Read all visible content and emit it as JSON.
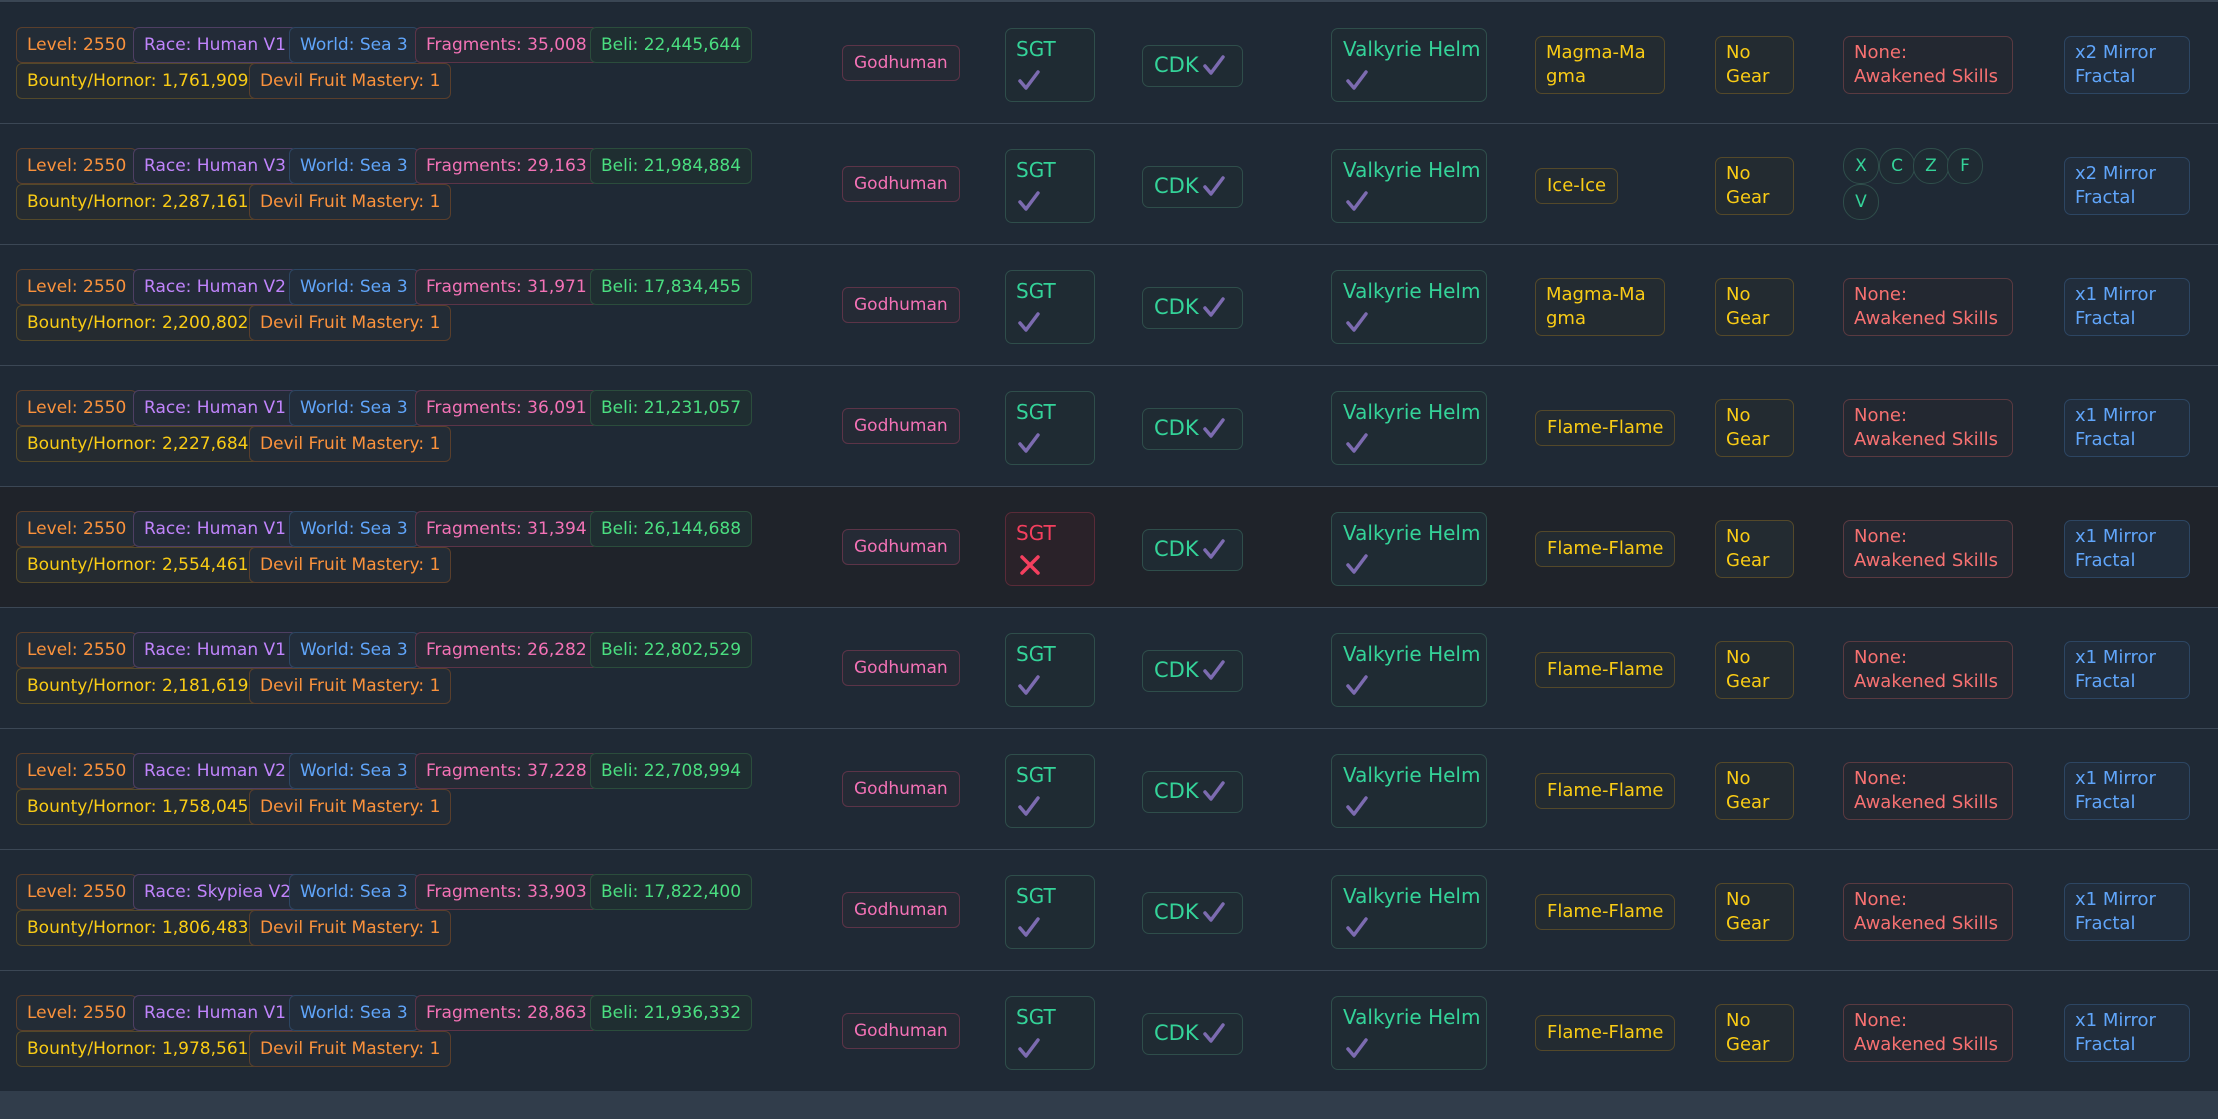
{
  "rows": [
    {
      "level": "Level: 2550",
      "race": "Race: Human V1",
      "world": "World: Sea 3",
      "fragments": "Fragments: 35,008",
      "beli": "Beli: 22,445,644",
      "bounty": "Bounty/Hornor: 1,761,909",
      "mastery": "Devil Fruit Mastery: 1",
      "style": "Godhuman",
      "sgt_label": "SGT",
      "sgt_ok": true,
      "cdk_label": "CDK",
      "helm_label": "Valkyrie Helm",
      "fruit": "Magma-Magma",
      "gear": "No Gear",
      "awakened": "None: Awakened Skills",
      "awakened_keys": [],
      "mirror": "x2 Mirror Fractal",
      "dim": false
    },
    {
      "level": "Level: 2550",
      "race": "Race: Human V3",
      "world": "World: Sea 3",
      "fragments": "Fragments: 29,163",
      "beli": "Beli: 21,984,884",
      "bounty": "Bounty/Hornor: 2,287,161",
      "mastery": "Devil Fruit Mastery: 1",
      "style": "Godhuman",
      "sgt_label": "SGT",
      "sgt_ok": true,
      "cdk_label": "CDK",
      "helm_label": "Valkyrie Helm",
      "fruit": "Ice-Ice",
      "gear": "No Gear",
      "awakened": "",
      "awakened_keys": [
        "X",
        "C",
        "Z",
        "F",
        "V"
      ],
      "mirror": "x2 Mirror Fractal",
      "dim": false
    },
    {
      "level": "Level: 2550",
      "race": "Race: Human V2",
      "world": "World: Sea 3",
      "fragments": "Fragments: 31,971",
      "beli": "Beli: 17,834,455",
      "bounty": "Bounty/Hornor: 2,200,802",
      "mastery": "Devil Fruit Mastery: 1",
      "style": "Godhuman",
      "sgt_label": "SGT",
      "sgt_ok": true,
      "cdk_label": "CDK",
      "helm_label": "Valkyrie Helm",
      "fruit": "Magma-Magma",
      "gear": "No Gear",
      "awakened": "None: Awakened Skills",
      "awakened_keys": [],
      "mirror": "x1 Mirror Fractal",
      "dim": false
    },
    {
      "level": "Level: 2550",
      "race": "Race: Human V1",
      "world": "World: Sea 3",
      "fragments": "Fragments: 36,091",
      "beli": "Beli: 21,231,057",
      "bounty": "Bounty/Hornor: 2,227,684",
      "mastery": "Devil Fruit Mastery: 1",
      "style": "Godhuman",
      "sgt_label": "SGT",
      "sgt_ok": true,
      "cdk_label": "CDK",
      "helm_label": "Valkyrie Helm",
      "fruit": "Flame-Flame",
      "gear": "No Gear",
      "awakened": "None: Awakened Skills",
      "awakened_keys": [],
      "mirror": "x1 Mirror Fractal",
      "dim": false
    },
    {
      "level": "Level: 2550",
      "race": "Race: Human V1",
      "world": "World: Sea 3",
      "fragments": "Fragments: 31,394",
      "beli": "Beli: 26,144,688",
      "bounty": "Bounty/Hornor: 2,554,461",
      "mastery": "Devil Fruit Mastery: 1",
      "style": "Godhuman",
      "sgt_label": "SGT",
      "sgt_ok": false,
      "cdk_label": "CDK",
      "helm_label": "Valkyrie Helm",
      "fruit": "Flame-Flame",
      "gear": "No Gear",
      "awakened": "None: Awakened Skills",
      "awakened_keys": [],
      "mirror": "x1 Mirror Fractal",
      "dim": true
    },
    {
      "level": "Level: 2550",
      "race": "Race: Human V1",
      "world": "World: Sea 3",
      "fragments": "Fragments: 26,282",
      "beli": "Beli: 22,802,529",
      "bounty": "Bounty/Hornor: 2,181,619",
      "mastery": "Devil Fruit Mastery: 1",
      "style": "Godhuman",
      "sgt_label": "SGT",
      "sgt_ok": true,
      "cdk_label": "CDK",
      "helm_label": "Valkyrie Helm",
      "fruit": "Flame-Flame",
      "gear": "No Gear",
      "awakened": "None: Awakened Skills",
      "awakened_keys": [],
      "mirror": "x1 Mirror Fractal",
      "dim": false
    },
    {
      "level": "Level: 2550",
      "race": "Race: Human V2",
      "world": "World: Sea 3",
      "fragments": "Fragments: 37,228",
      "beli": "Beli: 22,708,994",
      "bounty": "Bounty/Hornor: 1,758,045",
      "mastery": "Devil Fruit Mastery: 1",
      "style": "Godhuman",
      "sgt_label": "SGT",
      "sgt_ok": true,
      "cdk_label": "CDK",
      "helm_label": "Valkyrie Helm",
      "fruit": "Flame-Flame",
      "gear": "No Gear",
      "awakened": "None: Awakened Skills",
      "awakened_keys": [],
      "mirror": "x1 Mirror Fractal",
      "dim": false
    },
    {
      "level": "Level: 2550",
      "race": "Race: Skypiea V2",
      "world": "World: Sea 3",
      "fragments": "Fragments: 33,903",
      "beli": "Beli: 17,822,400",
      "bounty": "Bounty/Hornor: 1,806,483",
      "mastery": "Devil Fruit Mastery: 1",
      "style": "Godhuman",
      "sgt_label": "SGT",
      "sgt_ok": true,
      "cdk_label": "CDK",
      "helm_label": "Valkyrie Helm",
      "fruit": "Flame-Flame",
      "gear": "No Gear",
      "awakened": "None: Awakened Skills",
      "awakened_keys": [],
      "mirror": "x1 Mirror Fractal",
      "dim": false
    },
    {
      "level": "Level: 2550",
      "race": "Race: Human V1",
      "world": "World: Sea 3",
      "fragments": "Fragments: 28,863",
      "beli": "Beli: 21,936,332",
      "bounty": "Bounty/Hornor: 1,978,561",
      "mastery": "Devil Fruit Mastery: 1",
      "style": "Godhuman",
      "sgt_label": "SGT",
      "sgt_ok": true,
      "cdk_label": "CDK",
      "helm_label": "Valkyrie Helm",
      "fruit": "Flame-Flame",
      "gear": "No Gear",
      "awakened": "None: Awakened Skills",
      "awakened_keys": [],
      "mirror": "x1 Mirror Fractal",
      "dim": false
    }
  ],
  "icons": {
    "ok": "check-icon",
    "fail": "x-icon"
  },
  "colors": {
    "check": "#7c6bb0",
    "x": "#f43f5e"
  }
}
